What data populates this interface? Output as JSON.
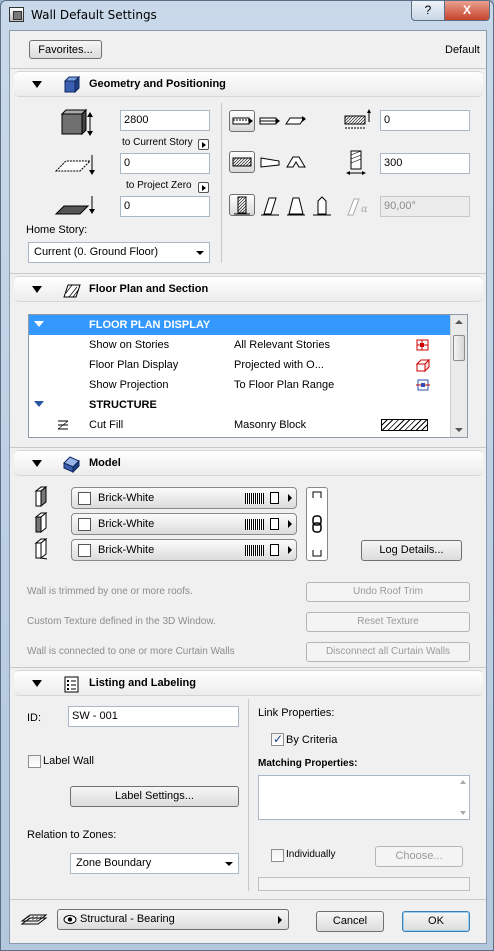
{
  "window": {
    "title": "Wall Default Settings",
    "help_label": "?",
    "close_label": "X"
  },
  "top": {
    "favorites_label": "Favorites...",
    "profile_label": "Default"
  },
  "geometry": {
    "header": "Geometry and Positioning",
    "top_offset_value": "2800",
    "top_link_label": "to Current Story",
    "bottom_offset_value": "0",
    "bottom_link_label": "to Project Zero",
    "base_offset_value": "0",
    "home_story_label": "Home Story:",
    "home_story_value": "Current (0. Ground Floor)",
    "offset_right_value": "0",
    "thickness_value": "300",
    "angle_value": "90,00°"
  },
  "floorplan": {
    "header": "Floor Plan and Section",
    "rows": [
      {
        "c1": "FLOOR PLAN DISPLAY",
        "c2": "",
        "kind": "selected-group"
      },
      {
        "c1": "Show on Stories",
        "c2": "All Relevant Stories",
        "kind": "row"
      },
      {
        "c1": "Floor Plan Display",
        "c2": "Projected with O...",
        "kind": "row"
      },
      {
        "c1": "Show Projection",
        "c2": "To Floor Plan Range",
        "kind": "row"
      },
      {
        "c1": "STRUCTURE",
        "c2": "",
        "kind": "group"
      },
      {
        "c1": "Cut Fill",
        "c2": "Masonry Block",
        "kind": "row"
      }
    ]
  },
  "model": {
    "header": "Model",
    "materials": [
      "Brick-White",
      "Brick-White",
      "Brick-White"
    ],
    "log_details_label": "Log Details...",
    "roof_msg": "Wall is trimmed by one or more roofs.",
    "undo_roof_label": "Undo Roof Trim",
    "texture_msg": "Custom Texture defined in the 3D Window.",
    "reset_texture_label": "Reset Texture",
    "curtain_msg": "Wall is connected to one or more Curtain Walls",
    "disconnect_label": "Disconnect all Curtain Walls"
  },
  "listing": {
    "header": "Listing and Labeling",
    "id_label": "ID:",
    "id_value": "SW - 001",
    "label_wall": "Label Wall",
    "label_settings": "Label Settings...",
    "relation_label": "Relation to Zones:",
    "relation_value": "Zone Boundary",
    "link_props_label": "Link Properties:",
    "by_criteria_label": "By Criteria",
    "matching_label": "Matching Properties:",
    "individually_label": "Individually",
    "choose_label": "Choose..."
  },
  "bottom": {
    "layer_value": "Structural - Bearing",
    "cancel_label": "Cancel",
    "ok_label": "OK"
  }
}
